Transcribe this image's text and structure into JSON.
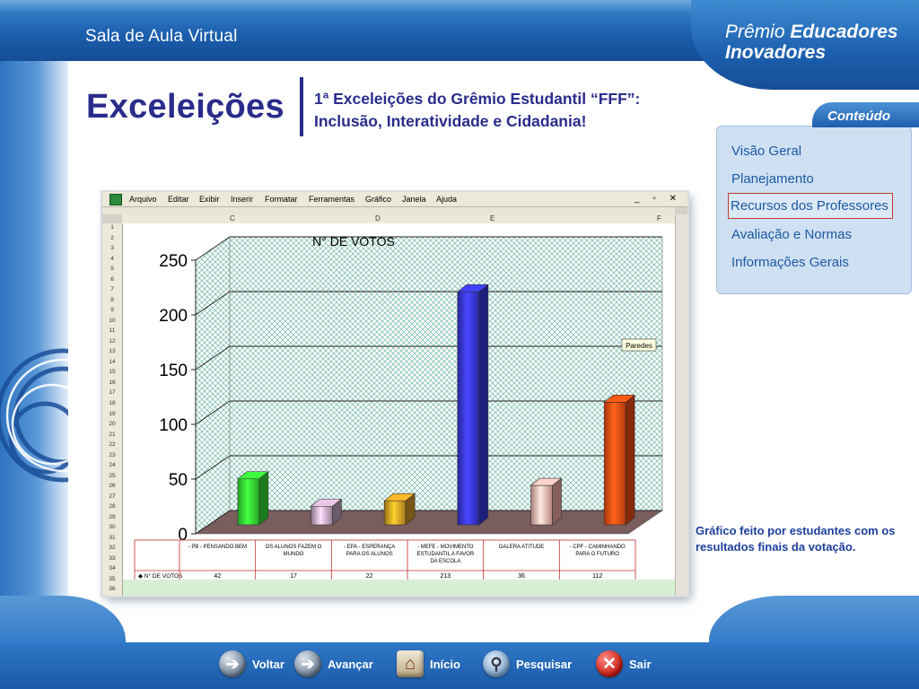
{
  "header": {
    "app_title": "Sala de Aula Virtual",
    "brand_line1_light": "Prêmio ",
    "brand_line1_bold": "Educadores",
    "brand_line2": "Inovadores"
  },
  "page": {
    "title": "Exceleições",
    "subtitle": "1ª Exceleições do Grêmio Estudantil “FFF”: Inclusão, Interatividade e Cidadania!"
  },
  "contents_panel": {
    "tab_label": "Conteúdo",
    "items": [
      {
        "label": "Visão Geral",
        "selected": false
      },
      {
        "label": "Planejamento",
        "selected": false
      },
      {
        "label": "Recursos dos Professores",
        "selected": true
      },
      {
        "label": "Avaliação e Normas",
        "selected": false
      },
      {
        "label": "Informações Gerais",
        "selected": false
      }
    ]
  },
  "spreadsheet": {
    "menu": [
      "Arquivo",
      "Editar",
      "Exibir",
      "Inserir",
      "Formatar",
      "Ferramentas",
      "Gráfico",
      "Janela",
      "Ajuda"
    ],
    "window_controls": "_ ▫ ✕",
    "columns": [
      "C",
      "D",
      "E",
      "F"
    ],
    "rows": [
      "1",
      "2",
      "3",
      "4",
      "5",
      "6",
      "7",
      "8",
      "9",
      "10",
      "11",
      "12",
      "13",
      "14",
      "15",
      "16",
      "17",
      "18",
      "19",
      "20",
      "21",
      "22",
      "23",
      "24",
      "25",
      "26",
      "27",
      "28",
      "29",
      "30",
      "31",
      "32",
      "33",
      "34",
      "35",
      "36"
    ]
  },
  "chart_data": {
    "type": "bar",
    "title": "N° DE VOTOS",
    "categories": [
      "- PB - PENSANDO BEM",
      "OS ALUNOS FAZEM O MUNDO",
      "- EPA - ESPERANÇA PARA OS ALUNOS",
      "- MEFE - MOVIMENTO ESTUDANTIL A FAVOR DA ESCOLA",
      "GALERA ATITUDE",
      "- CPF - CAMINHANDO PARA O FUTURO"
    ],
    "series": [
      {
        "name": "N° DE VOTOS",
        "values": [
          42,
          17,
          22,
          213,
          36,
          112
        ]
      }
    ],
    "value_labels": [
      "42",
      "17",
      "22",
      "213",
      "36",
      "112"
    ],
    "ylim": [
      0,
      250
    ],
    "yticks": [
      0,
      50,
      100,
      150,
      200,
      250
    ],
    "grid": true,
    "wall_tooltip": "Paredes",
    "bar_colors": [
      "#33e233",
      "#c5a6c2",
      "#d99b22",
      "#3535e0",
      "#f4b0a8",
      "#f24a12"
    ]
  },
  "caption": "Gráfico feito por estudantes com os resultados finais da votação.",
  "nav": {
    "back": "Voltar",
    "forward": "Avançar",
    "home": "Início",
    "search": "Pesquisar",
    "exit": "Sair"
  }
}
